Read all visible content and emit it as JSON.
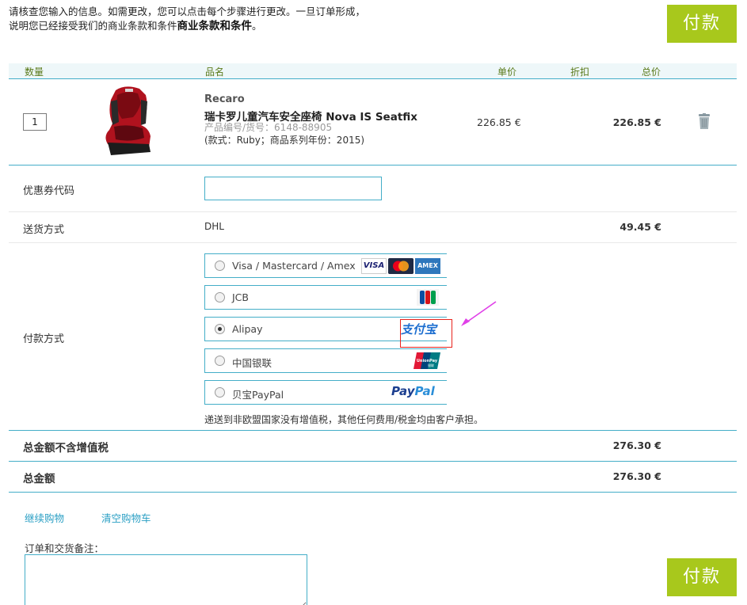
{
  "notice": {
    "line1": "请核查您输入的信息。如需更改，您可以点击每个步骤进行更改。一旦订单形成，",
    "line2_prefix": "说明您已经接受我们的商业条款和条件",
    "line2_bold": "商业条款和条件",
    "line2_suffix": "。"
  },
  "pay_button_label": "付款",
  "table_header": {
    "qty": "数量",
    "name": "品名",
    "unit_price": "单价",
    "discount": "折扣",
    "total": "总价"
  },
  "cart_item": {
    "quantity": "1",
    "brand": "Recaro",
    "name": "瑞卡罗儿童汽车安全座椅 Nova IS Seatfix",
    "sku": "产品编号/货号：6148-88905",
    "variant": "(款式：Ruby；商品系列年份：2015)",
    "unit_price": "226.85 €",
    "total_price": "226.85 €"
  },
  "coupon": {
    "label": "优惠券代码",
    "value": ""
  },
  "shipping": {
    "label": "送货方式",
    "method": "DHL",
    "cost": "49.45 €"
  },
  "payment": {
    "label": "付款方式",
    "selected": "Alipay",
    "options": [
      {
        "label": "Visa / Mastercard / Amex",
        "logos": [
          "VISA",
          "mastercard",
          "AMEX"
        ]
      },
      {
        "label": "JCB",
        "logos": [
          "jcb"
        ]
      },
      {
        "label": "Alipay",
        "logos": [
          "支付宝"
        ]
      },
      {
        "label": "中国银联",
        "logos": [
          "UnionPay 银联"
        ]
      },
      {
        "label": "贝宝PayPal",
        "logos": [
          "PayPal"
        ]
      }
    ],
    "vat_note": "递送到非欧盟国家没有增值税，其他任何费用/税金均由客户承担。"
  },
  "totals": {
    "excl_vat_label": "总金额不含增值税",
    "excl_vat_value": "276.30 €",
    "total_label": "总金额",
    "total_value": "276.30 €"
  },
  "links": {
    "continue_shopping": "继续购物",
    "empty_cart": "清空购物车"
  },
  "order_notes": {
    "label": "订单和交货备注：",
    "value": ""
  },
  "colors": {
    "pay_button": "#a8c81c",
    "teal_border": "#44aec8",
    "link": "#2a9fc4",
    "header_text": "#5a7a1a",
    "annotation_arrow": "#e040e8",
    "annotation_box": "#e8231c"
  }
}
